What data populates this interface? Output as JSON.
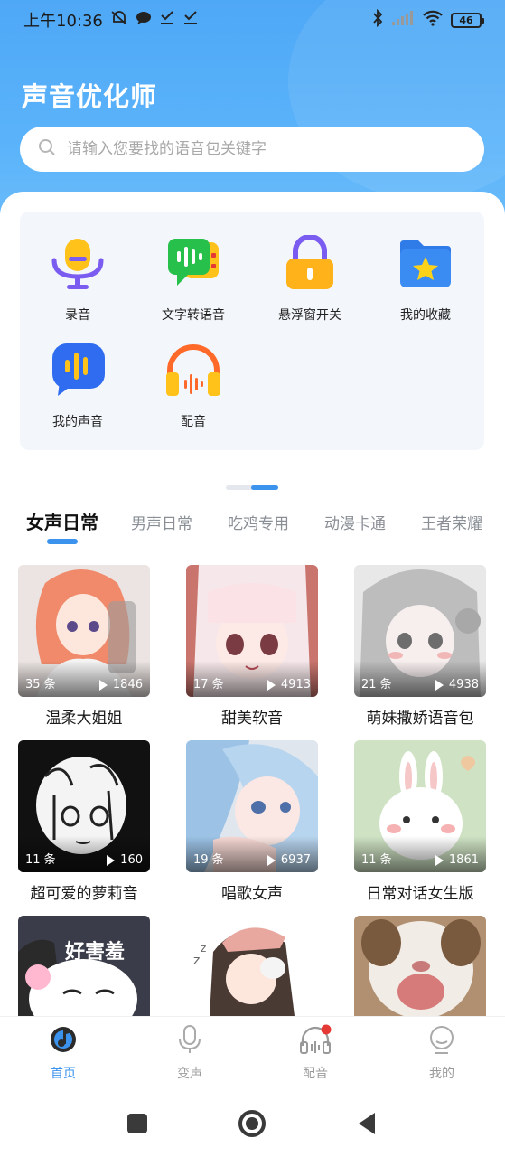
{
  "status_bar": {
    "time": "上午10:36",
    "battery": "46"
  },
  "app": {
    "title": "声音优化师"
  },
  "search": {
    "placeholder": "请输入您要找的语音包关键字"
  },
  "features": [
    {
      "label": "录音",
      "icon": "microphone-icon"
    },
    {
      "label": "文字转语音",
      "icon": "text-to-speech-icon"
    },
    {
      "label": "悬浮窗开关",
      "icon": "lock-icon"
    },
    {
      "label": "我的收藏",
      "icon": "star-folder-icon"
    },
    {
      "label": "我的声音",
      "icon": "voice-bubble-icon"
    },
    {
      "label": "配音",
      "icon": "headphones-icon"
    }
  ],
  "tabs": [
    {
      "label": "女声日常",
      "active": true
    },
    {
      "label": "男声日常"
    },
    {
      "label": "吃鸡专用"
    },
    {
      "label": "动漫卡通"
    },
    {
      "label": "王者荣耀"
    }
  ],
  "cards": [
    {
      "title": "温柔大姐姐",
      "count": "35 条",
      "plays": "1846"
    },
    {
      "title": "甜美软音",
      "count": "17 条",
      "plays": "4913"
    },
    {
      "title": "萌妹撒娇语音包",
      "count": "21 条",
      "plays": "4938"
    },
    {
      "title": "超可爱的萝莉音",
      "count": "11 条",
      "plays": "160"
    },
    {
      "title": "唱歌女声",
      "count": "19 条",
      "plays": "6937"
    },
    {
      "title": "日常对话女生版",
      "count": "11 条",
      "plays": "1861"
    },
    {
      "caption": "好害羞"
    },
    {},
    {}
  ],
  "bottom_nav": [
    {
      "label": "首页",
      "active": true
    },
    {
      "label": "变声"
    },
    {
      "label": "配音"
    },
    {
      "label": "我的"
    }
  ],
  "colors": {
    "accent": "#3b93ee",
    "header_top": "#4fa8f6",
    "nav_badge": "#e53935"
  }
}
